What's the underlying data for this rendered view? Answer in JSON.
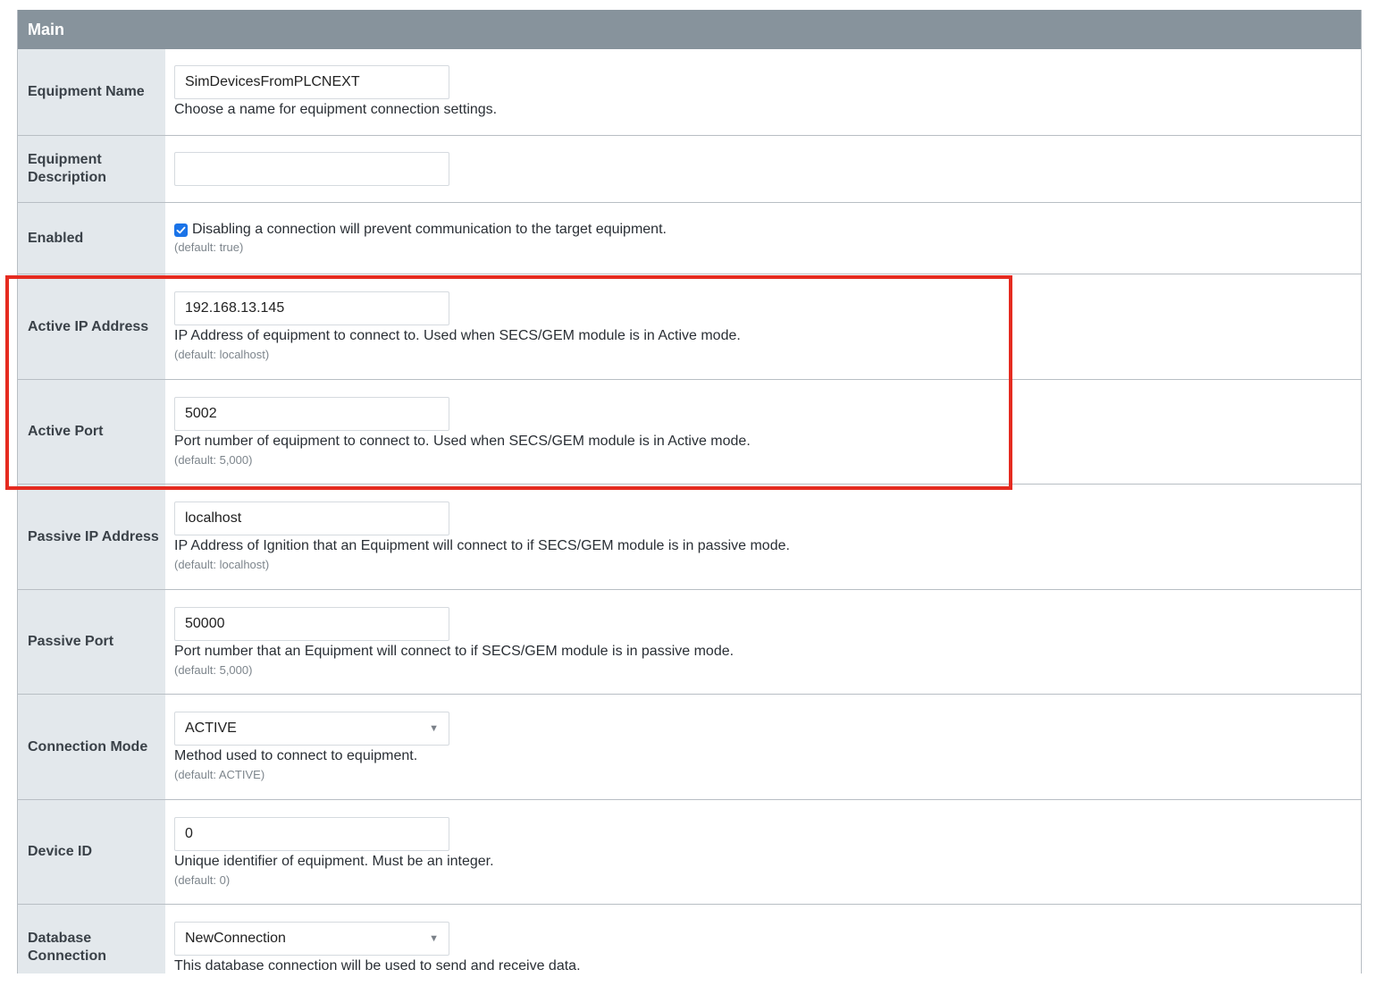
{
  "section": {
    "title": "Main"
  },
  "fields": {
    "equipment_name": {
      "label": "Equipment Name",
      "value": "SimDevicesFromPLCNEXT",
      "help": "Choose a name for equipment connection settings."
    },
    "equipment_description": {
      "label": "Equipment Description",
      "value": ""
    },
    "enabled": {
      "label": "Enabled",
      "checked": true,
      "help": "Disabling a connection will prevent communication to the target equipment.",
      "default": "(default: true)"
    },
    "active_ip_address": {
      "label": "Active IP Address",
      "value": "192.168.13.145",
      "help": "IP Address of equipment to connect to. Used when SECS/GEM module is in Active mode.",
      "default": "(default: localhost)"
    },
    "active_port": {
      "label": "Active Port",
      "value": "5002",
      "help": "Port number of equipment to connect to. Used when SECS/GEM module is in Active mode.",
      "default": "(default: 5,000)"
    },
    "passive_ip_address": {
      "label": "Passive IP Address",
      "value": "localhost",
      "help": "IP Address of Ignition that an Equipment will connect to if SECS/GEM module is in passive mode.",
      "default": "(default: localhost)"
    },
    "passive_port": {
      "label": "Passive Port",
      "value": "50000",
      "help": "Port number that an Equipment will connect to if SECS/GEM module is in passive mode.",
      "default": "(default: 5,000)"
    },
    "connection_mode": {
      "label": "Connection Mode",
      "value": "ACTIVE",
      "help": "Method used to connect to equipment.",
      "default": "(default: ACTIVE)"
    },
    "device_id": {
      "label": "Device ID",
      "value": "0",
      "help": "Unique identifier of equipment. Must be an integer.",
      "default": "(default: 0)"
    },
    "database_connection": {
      "label": "Database Connection",
      "value": "NewConnection",
      "help": "This database connection will be used to send and receive data."
    }
  },
  "colors": {
    "header_bg": "#87939c",
    "label_bg": "#e3e8ec",
    "highlight": "#e52b20",
    "checkbox": "#1a73e8"
  }
}
